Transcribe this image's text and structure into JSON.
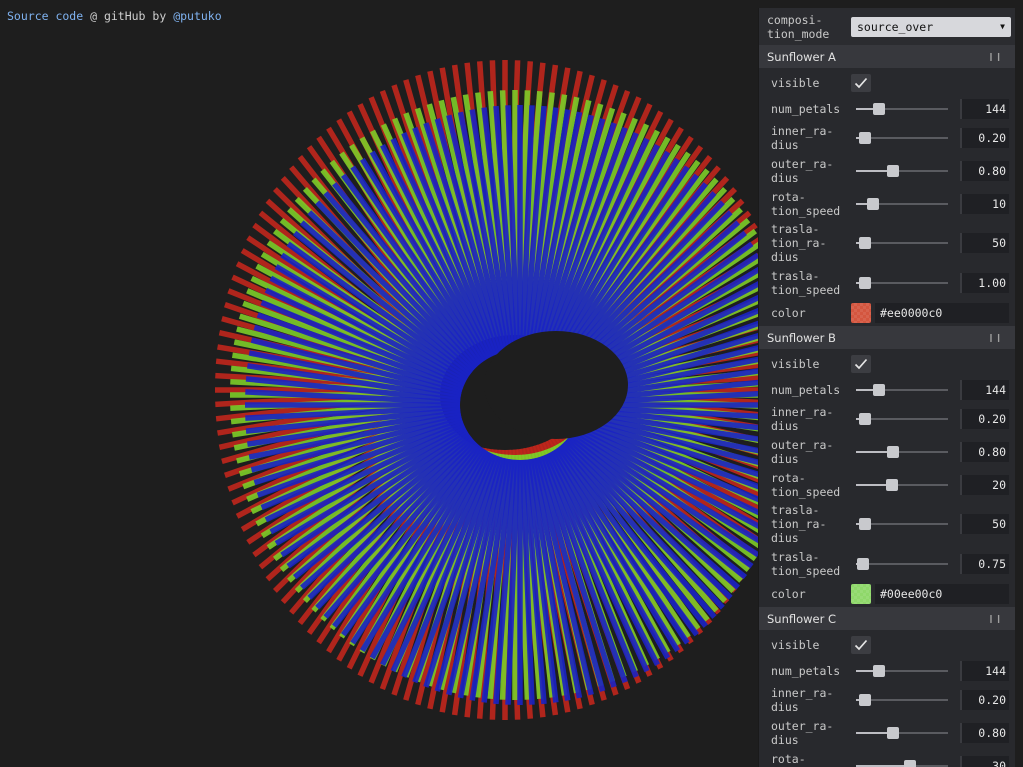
{
  "credit": {
    "source_link": "Source code",
    "middle": " @ gitHub by ",
    "author_link": "@putuko"
  },
  "panel": {
    "composition_mode": {
      "label": "composi-\ntion_mode",
      "value": "source_over"
    },
    "folders": [
      {
        "title": "Sunflower A",
        "visible": true,
        "color_hex": "#ee0000c0",
        "swatch_color": "#d4563f",
        "props": [
          {
            "key": "num_petals",
            "label": "num_petals",
            "value": "144",
            "fill": 0.25
          },
          {
            "key": "inner_radius",
            "label": "inner_ra-\ndius",
            "value": "0.20",
            "fill": 0.1
          },
          {
            "key": "outer_radius",
            "label": "outer_ra-\ndius",
            "value": "0.80",
            "fill": 0.4
          },
          {
            "key": "rotation_speed",
            "label": "rota-\ntion_speed",
            "value": "10",
            "fill": 0.18
          },
          {
            "key": "traslation_radius",
            "label": "trasla-\ntion_ra-\ndius",
            "value": "50",
            "fill": 0.1
          },
          {
            "key": "traslation_speed",
            "label": "trasla-\ntion_speed",
            "value": "1.00",
            "fill": 0.1
          }
        ]
      },
      {
        "title": "Sunflower B",
        "visible": true,
        "color_hex": "#00ee00c0",
        "swatch_color": "#8fd86a",
        "props": [
          {
            "key": "num_petals",
            "label": "num_petals",
            "value": "144",
            "fill": 0.25
          },
          {
            "key": "inner_radius",
            "label": "inner_ra-\ndius",
            "value": "0.20",
            "fill": 0.1
          },
          {
            "key": "outer_radius",
            "label": "outer_ra-\ndius",
            "value": "0.80",
            "fill": 0.4
          },
          {
            "key": "rotation_speed",
            "label": "rota-\ntion_speed",
            "value": "20",
            "fill": 0.39
          },
          {
            "key": "traslation_radius",
            "label": "trasla-\ntion_ra-\ndius",
            "value": "50",
            "fill": 0.1
          },
          {
            "key": "traslation_speed",
            "label": "trasla-\ntion_speed",
            "value": "0.75",
            "fill": 0.08
          }
        ]
      },
      {
        "title": "Sunflower C",
        "visible": true,
        "props": [
          {
            "key": "num_petals",
            "label": "num_petals",
            "value": "144",
            "fill": 0.25
          },
          {
            "key": "inner_radius",
            "label": "inner_ra-\ndius",
            "value": "0.20",
            "fill": 0.1
          },
          {
            "key": "outer_radius",
            "label": "outer_ra-\ndius",
            "value": "0.80",
            "fill": 0.4
          },
          {
            "key": "rotation_speed",
            "label": "rota-\ntion_speed",
            "value": "30",
            "fill": 0.59
          }
        ]
      }
    ],
    "labels": {
      "visible": "visible",
      "color": "color"
    }
  },
  "visual": {
    "colors": {
      "red": "#c0261c",
      "green": "#7ccc28",
      "blue": "#1a22c4"
    },
    "petal_count": 144
  }
}
